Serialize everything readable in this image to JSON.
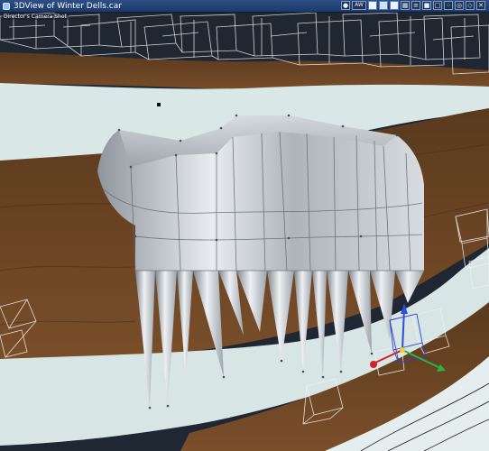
{
  "window": {
    "title": "3DView of Winter Dells.car",
    "camera_label": "Director's Camera Shot"
  },
  "toolbar": {
    "camera_icon": "camera-icon",
    "persp_label": "AW",
    "buttons": [
      "view-single-icon",
      "view-split-icon",
      "view-quad-icon",
      "view-grid-icon",
      "layers-icon",
      "cube-icon",
      "cube-wire-icon",
      "dots-icon",
      "target-icon",
      "expand-icon",
      "close-icon"
    ]
  },
  "colors": {
    "titlebar": "#1b3a6b",
    "terrain_brown": "#6b4424",
    "ice": "#d6e4e4",
    "sky": "#1f2733",
    "mesh": "#b7bcc2",
    "axis_x": "#d41e28",
    "axis_y": "#2a4fd6",
    "axis_z": "#28b44a"
  }
}
